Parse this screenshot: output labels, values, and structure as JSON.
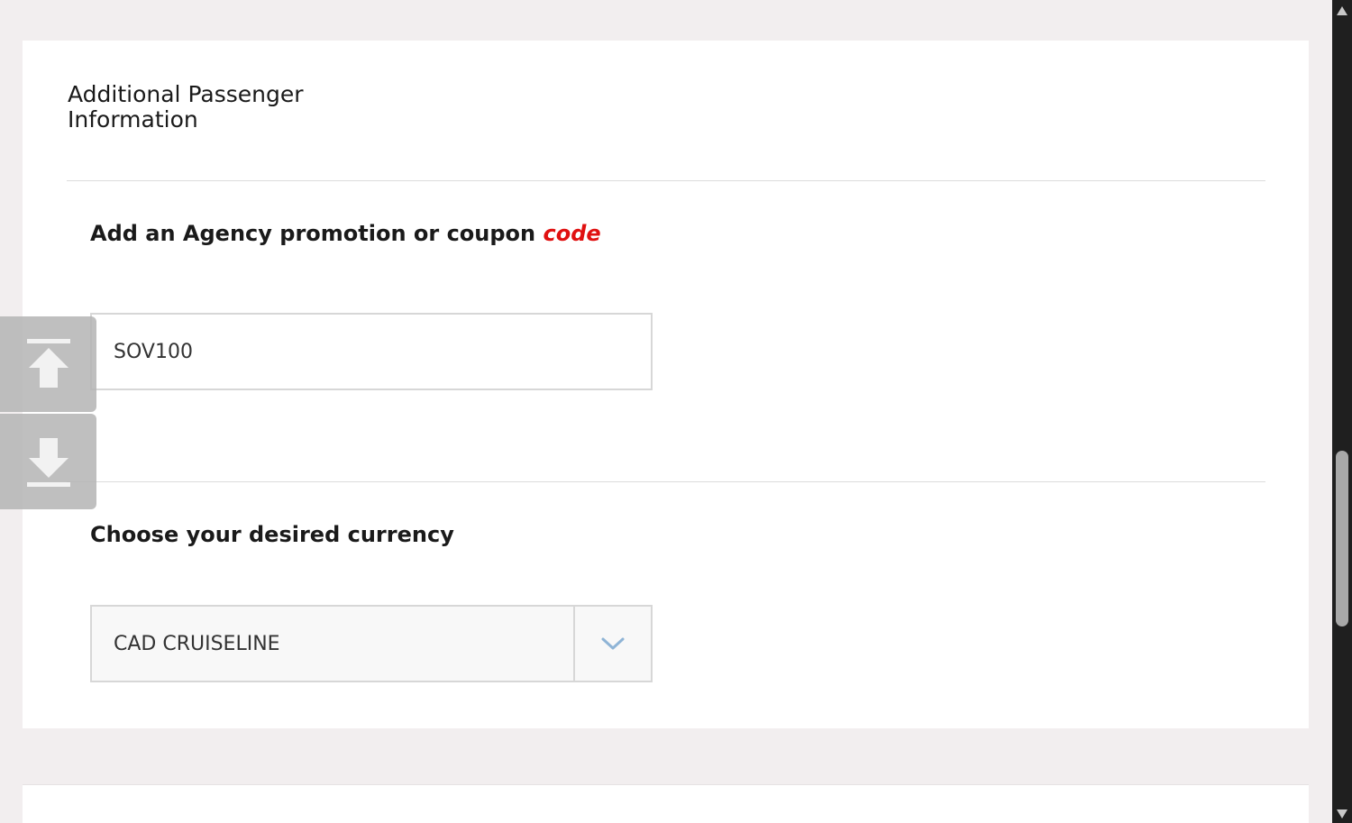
{
  "passenger": {
    "title": "Additional Passenger Information"
  },
  "promo": {
    "label_main": "Add an Agency promotion or coupon",
    "label_accent": "code",
    "accent_color": "#e01010",
    "input_value": "SOV100"
  },
  "currency": {
    "label": "Choose your desired currency",
    "selected": "CAD CRUISELINE",
    "arrow_color": "#8fb4d6"
  },
  "icons": {
    "scroll_top": "arrow-up-to-line-icon",
    "scroll_bottom": "arrow-down-to-line-icon",
    "dropdown": "chevron-down-icon"
  }
}
